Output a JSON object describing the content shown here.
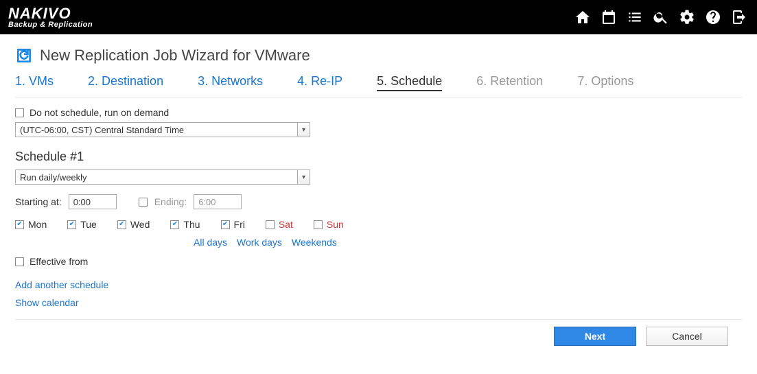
{
  "brand": {
    "name": "NAKIVO",
    "tagline": "Backup & Replication"
  },
  "page_title": "New Replication Job Wizard for VMware",
  "tabs": [
    {
      "label": "1. VMs",
      "state": "done"
    },
    {
      "label": "2. Destination",
      "state": "done"
    },
    {
      "label": "3. Networks",
      "state": "done"
    },
    {
      "label": "4. Re-IP",
      "state": "done"
    },
    {
      "label": "5. Schedule",
      "state": "active"
    },
    {
      "label": "6. Retention",
      "state": "future"
    },
    {
      "label": "7. Options",
      "state": "future"
    }
  ],
  "schedule": {
    "do_not_schedule_label": "Do not schedule, run on demand",
    "do_not_schedule_checked": false,
    "timezone": "(UTC-06:00, CST) Central Standard Time",
    "section_title": "Schedule #1",
    "frequency": "Run daily/weekly",
    "starting_label": "Starting at:",
    "starting_value": "0:00",
    "ending_label": "Ending:",
    "ending_value": "6:00",
    "ending_checked": false,
    "days": [
      {
        "label": "Mon",
        "checked": true,
        "weekend": false
      },
      {
        "label": "Tue",
        "checked": true,
        "weekend": false
      },
      {
        "label": "Wed",
        "checked": true,
        "weekend": false
      },
      {
        "label": "Thu",
        "checked": true,
        "weekend": false
      },
      {
        "label": "Fri",
        "checked": true,
        "weekend": false
      },
      {
        "label": "Sat",
        "checked": false,
        "weekend": true
      },
      {
        "label": "Sun",
        "checked": false,
        "weekend": true
      }
    ],
    "presets": {
      "all": "All days",
      "work": "Work days",
      "weekends": "Weekends"
    },
    "effective_from_label": "Effective from",
    "effective_from_checked": false,
    "add_schedule_link": "Add another schedule",
    "show_calendar_link": "Show calendar"
  },
  "buttons": {
    "next": "Next",
    "cancel": "Cancel"
  }
}
